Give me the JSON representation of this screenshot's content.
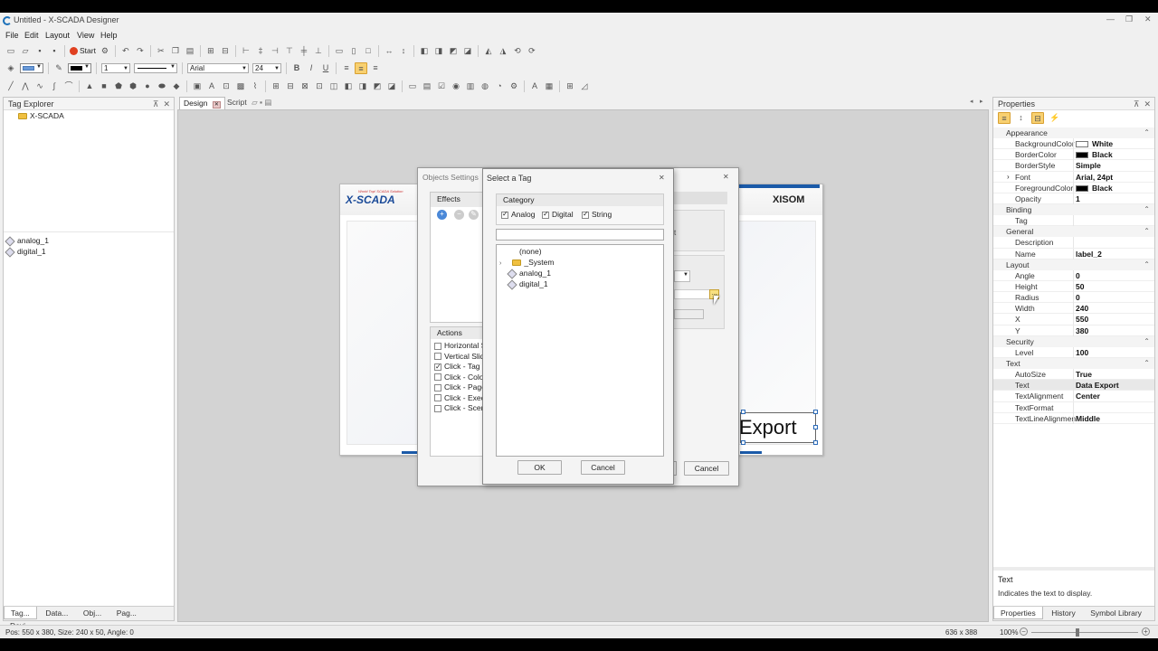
{
  "window": {
    "title": "Untitled - X-SCADA Designer",
    "minimize": "—",
    "restore": "❐",
    "close": "✕"
  },
  "menu": [
    "File",
    "Edit",
    "Layout",
    "View",
    "Help"
  ],
  "toolbar": {
    "start_label": "Start",
    "font_name": "Arial",
    "font_size": "24",
    "line_width": "1"
  },
  "tag_explorer": {
    "title": "Tag Explorer",
    "root": "X-SCADA",
    "tags": [
      "analog_1",
      "digital_1"
    ],
    "bottom_tabs": [
      "Tag...",
      "Data...",
      "Obj...",
      "Pag...",
      "Devi..."
    ]
  },
  "doc_tabs": [
    {
      "label": "Design"
    },
    {
      "label": "Script"
    }
  ],
  "canvas": {
    "logo_text": "X-SCADA",
    "logo_subtitle": "World Top! SCADA Solution",
    "right_logo": "XISOM",
    "label_text": "Export"
  },
  "objects_settings": {
    "title": "Objects Settings",
    "effects_label": "Effects",
    "actions_label": "Actions",
    "actions": [
      {
        "label": "Horizontal S",
        "checked": false
      },
      {
        "label": "Vertical Slid",
        "checked": false
      },
      {
        "label": "Click - Tag V",
        "checked": true
      },
      {
        "label": "Click - Color",
        "checked": false
      },
      {
        "label": "Click - Page",
        "checked": false
      },
      {
        "label": "Click - Exec",
        "checked": false
      },
      {
        "label": "Click - Scen",
        "checked": false
      }
    ],
    "partial_text": "t",
    "cancel": "Cancel"
  },
  "select_tag": {
    "title": "Select a Tag",
    "category_label": "Category",
    "categories": [
      {
        "label": "Analog",
        "checked": true
      },
      {
        "label": "Digital",
        "checked": true
      },
      {
        "label": "String",
        "checked": true
      }
    ],
    "search_value": "",
    "tree": [
      {
        "label": "(none)",
        "type": "none"
      },
      {
        "label": "_System",
        "type": "folder"
      },
      {
        "label": "analog_1",
        "type": "tag"
      },
      {
        "label": "digital_1",
        "type": "tag"
      }
    ],
    "ok": "OK",
    "cancel": "Cancel"
  },
  "properties": {
    "title": "Properties",
    "groups": [
      {
        "name": "Appearance",
        "rows": [
          {
            "key": "BackgroundColor",
            "value": "White",
            "swatch": "#ffffff"
          },
          {
            "key": "BorderColor",
            "value": "Black",
            "swatch": "#000000"
          },
          {
            "key": "BorderStyle",
            "value": "Simple"
          },
          {
            "key": "Font",
            "value": "Arial, 24pt",
            "expand": "›"
          },
          {
            "key": "ForegroundColor",
            "value": "Black",
            "swatch": "#000000"
          },
          {
            "key": "Opacity",
            "value": "1"
          }
        ]
      },
      {
        "name": "Binding",
        "rows": [
          {
            "key": "Tag",
            "value": ""
          }
        ]
      },
      {
        "name": "General",
        "rows": [
          {
            "key": "Description",
            "value": ""
          },
          {
            "key": "Name",
            "value": "label_2"
          }
        ]
      },
      {
        "name": "Layout",
        "rows": [
          {
            "key": "Angle",
            "value": "0"
          },
          {
            "key": "Height",
            "value": "50"
          },
          {
            "key": "Radius",
            "value": "0"
          },
          {
            "key": "Width",
            "value": "240"
          },
          {
            "key": "X",
            "value": "550"
          },
          {
            "key": "Y",
            "value": "380"
          }
        ]
      },
      {
        "name": "Security",
        "rows": [
          {
            "key": "Level",
            "value": "100"
          }
        ]
      },
      {
        "name": "Text",
        "rows": [
          {
            "key": "AutoSize",
            "value": "True"
          },
          {
            "key": "Text",
            "value": "Data Export"
          },
          {
            "key": "TextAlignment",
            "value": "Center"
          },
          {
            "key": "TextFormat",
            "value": ""
          },
          {
            "key": "TextLineAlignmen",
            "value": "Middle"
          }
        ]
      }
    ],
    "desc_title": "Text",
    "desc_text": "Indicates the text to display.",
    "bottom_tabs": [
      "Properties",
      "History",
      "Symbol Library"
    ]
  },
  "status": {
    "left": "Pos: 550 x 380, Size: 240 x 50, Angle: 0",
    "coords": "636 x 388",
    "zoom": "100%"
  }
}
